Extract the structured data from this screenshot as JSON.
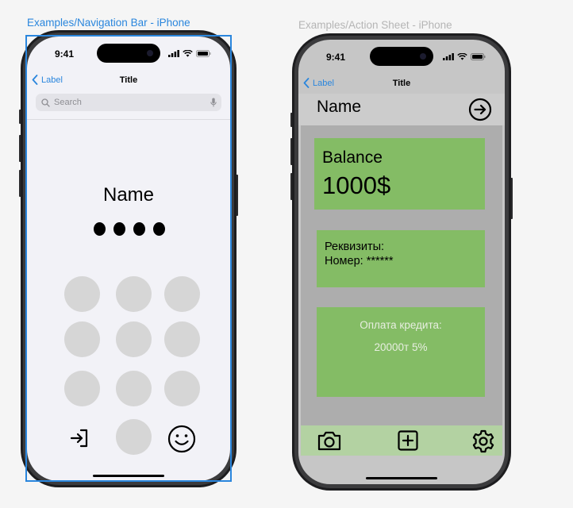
{
  "frames": {
    "left_label": "Examples/Navigation Bar - iPhone",
    "right_label": "Examples/Action Sheet - iPhone"
  },
  "status": {
    "time": "9:41"
  },
  "nav": {
    "back_label": "Label",
    "title": "Title"
  },
  "phone1": {
    "search_placeholder": "Search",
    "name": "Name",
    "pin_length": 4,
    "icons": [
      "login-icon",
      "smiley-icon",
      "search-icon",
      "mic-icon"
    ]
  },
  "phone2": {
    "name": "Name",
    "balance_label": "Balance",
    "balance_value": "1000$",
    "requisites_line1": "Реквизиты:",
    "requisites_line2": "Номер: ******",
    "credit_line1": "Оплата кредита:",
    "credit_line2": "20000т 5%",
    "tabs": [
      "camera-icon",
      "plus-square-icon",
      "gear-icon"
    ]
  },
  "colors": {
    "accent": "#2a86dd",
    "card_green": "#84bc65",
    "tabbar_green": "#b3d2a2",
    "key_gray": "#d6d6d6"
  }
}
